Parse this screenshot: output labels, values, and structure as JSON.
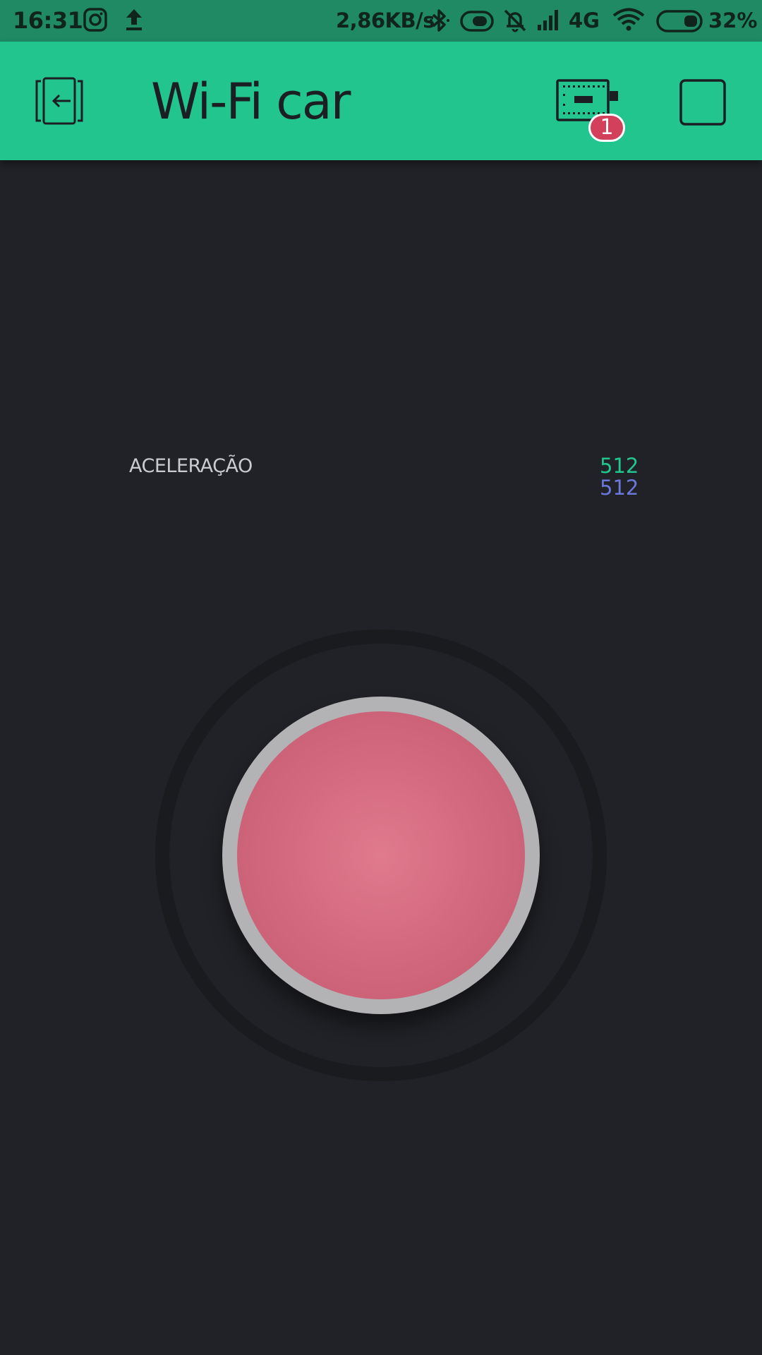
{
  "status_bar": {
    "time": "16:31",
    "net_speed": "2,86KB/s",
    "network_type": "4G",
    "battery_percent": "32%",
    "icons": [
      "instagram-icon",
      "upload-icon",
      "bluetooth-icon",
      "toggle-icon",
      "mute-icon",
      "signal-icon",
      "wifi-icon",
      "battery-icon"
    ]
  },
  "app_bar": {
    "title": "Wi-Fi car",
    "device_badge_count": "1",
    "icons": [
      "exit-icon",
      "device-icon",
      "square-icon"
    ],
    "colors": {
      "status_bar_bg": "#1f8a64",
      "app_bar_bg": "#23c58e",
      "badge_bg": "#d3405c"
    }
  },
  "joystick": {
    "label": "ACELERAÇÃO",
    "x_value": "512",
    "y_value": "512",
    "colors": {
      "x_value": "#23c58e",
      "y_value": "#6b78d9",
      "knob": "#d46a80",
      "background": "#212227"
    }
  }
}
